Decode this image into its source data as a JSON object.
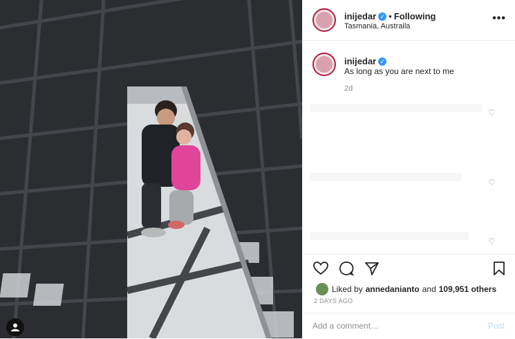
{
  "post": {
    "username": "inijedar",
    "follow_sep": "•",
    "follow_label": "Following",
    "location": "Tasmania, Austraila",
    "more_label": "•••",
    "caption_user": "inijedar",
    "caption": "As long as you are next to me",
    "caption_time": "2d",
    "liked_by_prefix": "Liked by",
    "liked_by_user": "annedanianto",
    "liked_by_and": "and",
    "likes_count": "109,951 others",
    "date": "2 DAYS AGO",
    "comment_placeholder": "Add a comment…",
    "post_label": "Post"
  },
  "icons": {
    "verified": "verified-badge-icon",
    "heart": "heart-icon",
    "comment": "comment-icon",
    "share": "share-icon",
    "save": "bookmark-icon",
    "more": "more-options-icon",
    "user": "user-glyph-icon"
  },
  "colors": {
    "verified_blue": "#3897f0",
    "post_button": "#b2dffc",
    "muted_text": "#8e8e8e"
  }
}
